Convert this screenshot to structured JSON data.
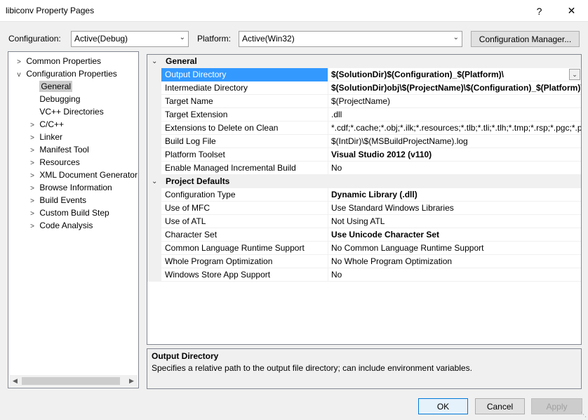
{
  "window": {
    "title": "libiconv Property Pages",
    "help_glyph": "?",
    "close_glyph": "✕"
  },
  "toolbar": {
    "configuration_label": "Configuration:",
    "configuration_value": "Active(Debug)",
    "platform_label": "Platform:",
    "platform_value": "Active(Win32)",
    "config_manager_label": "Configuration Manager..."
  },
  "tree": {
    "items": [
      {
        "label": "Common Properties",
        "expander": ">"
      },
      {
        "label": "Configuration Properties",
        "expander": "v"
      },
      {
        "label": "General",
        "expander": ""
      },
      {
        "label": "Debugging",
        "expander": ""
      },
      {
        "label": "VC++ Directories",
        "expander": ""
      },
      {
        "label": "C/C++",
        "expander": ">"
      },
      {
        "label": "Linker",
        "expander": ">"
      },
      {
        "label": "Manifest Tool",
        "expander": ">"
      },
      {
        "label": "Resources",
        "expander": ">"
      },
      {
        "label": "XML Document Generator",
        "expander": ">"
      },
      {
        "label": "Browse Information",
        "expander": ">"
      },
      {
        "label": "Build Events",
        "expander": ">"
      },
      {
        "label": "Custom Build Step",
        "expander": ">"
      },
      {
        "label": "Code Analysis",
        "expander": ">"
      }
    ]
  },
  "grid": {
    "sections": [
      {
        "title": "General",
        "rows": [
          {
            "name": "Output Directory",
            "value": "$(SolutionDir)$(Configuration)_$(Platform)\\",
            "bold": true
          },
          {
            "name": "Intermediate Directory",
            "value": "$(SolutionDir)obj\\$(ProjectName)\\$(Configuration)_$(Platform)\\",
            "bold": true
          },
          {
            "name": "Target Name",
            "value": "$(ProjectName)",
            "bold": false
          },
          {
            "name": "Target Extension",
            "value": ".dll",
            "bold": false
          },
          {
            "name": "Extensions to Delete on Clean",
            "value": "*.cdf;*.cache;*.obj;*.ilk;*.resources;*.tlb;*.tli;*.tlh;*.tmp;*.rsp;*.pgc;*.pgd",
            "bold": false
          },
          {
            "name": "Build Log File",
            "value": "$(IntDir)\\$(MSBuildProjectName).log",
            "bold": false
          },
          {
            "name": "Platform Toolset",
            "value": "Visual Studio 2012 (v110)",
            "bold": true
          },
          {
            "name": "Enable Managed Incremental Build",
            "value": "No",
            "bold": false
          }
        ]
      },
      {
        "title": "Project Defaults",
        "rows": [
          {
            "name": "Configuration Type",
            "value": "Dynamic Library (.dll)",
            "bold": true
          },
          {
            "name": "Use of MFC",
            "value": "Use Standard Windows Libraries",
            "bold": false
          },
          {
            "name": "Use of ATL",
            "value": "Not Using ATL",
            "bold": false
          },
          {
            "name": "Character Set",
            "value": "Use Unicode Character Set",
            "bold": true
          },
          {
            "name": "Common Language Runtime Support",
            "value": "No Common Language Runtime Support",
            "bold": false
          },
          {
            "name": "Whole Program Optimization",
            "value": "No Whole Program Optimization",
            "bold": false
          },
          {
            "name": "Windows Store App Support",
            "value": "No",
            "bold": false
          }
        ]
      }
    ],
    "dropdown_glyph": "⌄"
  },
  "description": {
    "title": "Output Directory",
    "text": "Specifies a relative path to the output file directory; can include environment variables."
  },
  "buttons": {
    "ok": "OK",
    "cancel": "Cancel",
    "apply": "Apply"
  },
  "colors": {
    "selection": "#3399ff",
    "tree_selection": "#cccccc",
    "primary_button_border": "#0078d7"
  }
}
